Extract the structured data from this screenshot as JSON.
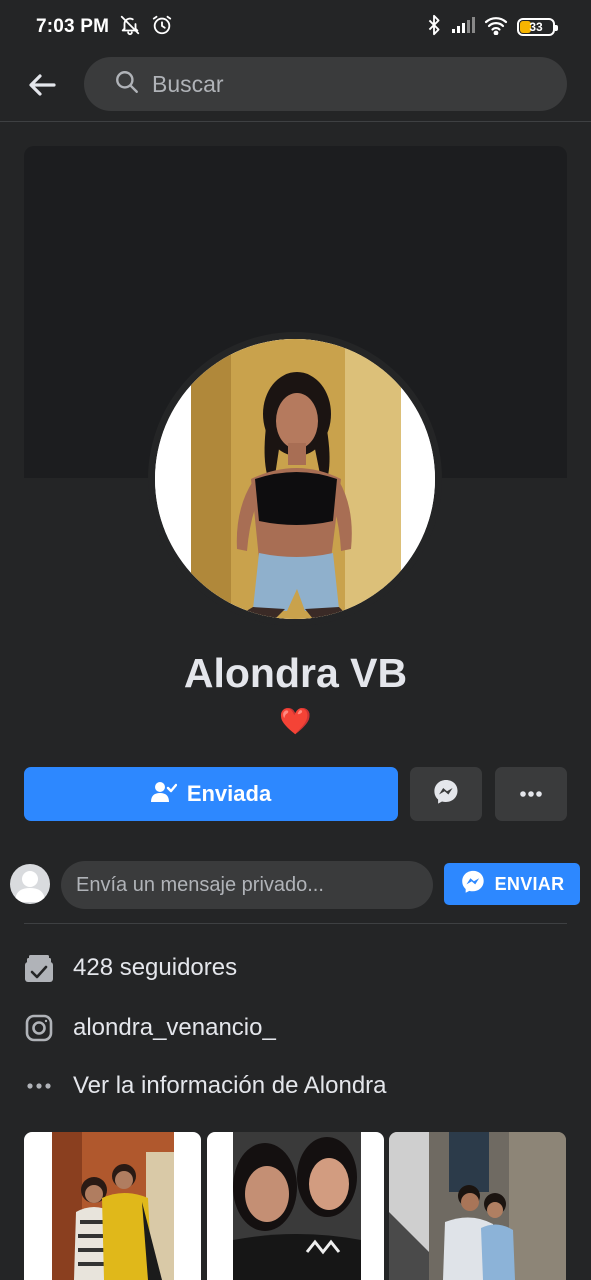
{
  "status_bar": {
    "time": "7:03 PM",
    "battery_level": "33",
    "icons": [
      "mute-notifications-icon",
      "alarm-icon",
      "bluetooth-icon",
      "signal-icon",
      "wifi-icon",
      "battery-icon"
    ]
  },
  "header": {
    "back_icon": "back-arrow-icon",
    "search": {
      "placeholder": "Buscar",
      "value": ""
    }
  },
  "profile": {
    "name": "Alondra VB",
    "bio": "❤️"
  },
  "actions": {
    "primary_label": "Enviada",
    "primary_icon": "friend-request-sent-icon",
    "messenger_icon": "messenger-icon",
    "more_icon": "more-options-icon"
  },
  "message": {
    "placeholder": "Envía un mensaje privado...",
    "value": "",
    "send_label": "ENVIAR"
  },
  "info": {
    "followers": "428 seguidores",
    "instagram": "alondra_venancio_",
    "see_info": "Ver la información de Alondra"
  },
  "photos": {
    "count_visible": 3
  },
  "colors": {
    "background": "#242526",
    "surface": "#3a3b3c",
    "cover": "#1c1d1f",
    "accent": "#2d88ff",
    "text_primary": "#e4e6eb",
    "text_secondary": "#b0b3b8",
    "heart": "#e41e3f"
  }
}
